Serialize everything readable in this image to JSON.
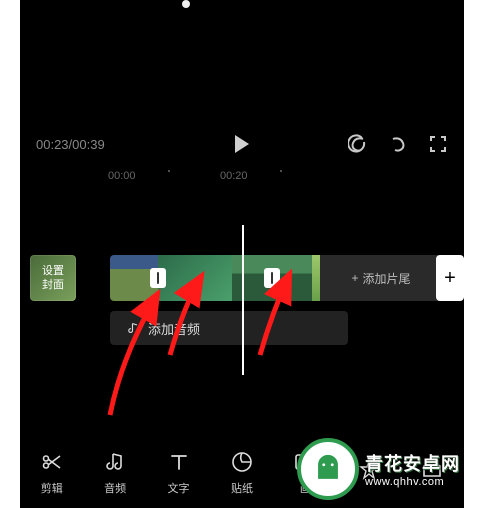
{
  "player": {
    "time_label": "00:23/00:39"
  },
  "ruler": {
    "t0": "00:00",
    "t1": "00:20"
  },
  "cover": {
    "line1": "设置",
    "line2": "封面"
  },
  "timeline": {
    "add_tail": "添加片尾",
    "add_tail_plus": "+",
    "add_audio": "添加音频",
    "plus": "+"
  },
  "toolbar": {
    "cut": "剪辑",
    "audio": "音频",
    "text": "文字",
    "sticker": "贴纸",
    "pip": "画",
    "effect": "",
    "extra": ""
  },
  "watermark": {
    "brand": "青花安卓网",
    "url": "www.qhhv.com"
  }
}
